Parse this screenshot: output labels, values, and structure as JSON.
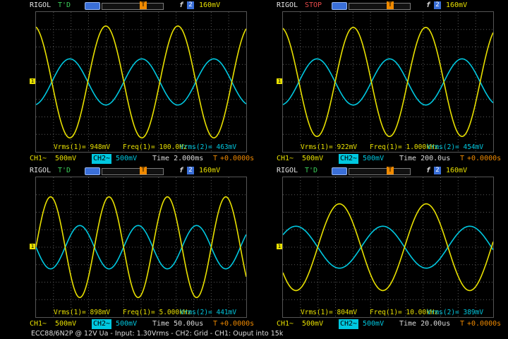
{
  "colors": {
    "ch1": "#e8e000",
    "ch2": "#00c8e0",
    "trigger": "#f08a00",
    "status_green": "#3cd05a"
  },
  "panels": [
    {
      "brand": "RIGOL",
      "status": "T'D",
      "trig_level": "160mV",
      "vrms1": "Vrms(1)= 948mV",
      "freq1": "Freq(1)= 100.0Hz",
      "vrms2": "Vrms(2)= 463mV",
      "ch1_label": "CH1~",
      "ch1_volt": "500mV",
      "ch2_label": "CH2~",
      "ch2_volt": "500mV",
      "time": "Time 2.000ms",
      "trig_pos": "+0.0000s",
      "cycles": 2.92,
      "phase": 0.78,
      "a1": 0.8,
      "a2": 0.33
    },
    {
      "brand": "RIGOL",
      "status": "STOP",
      "trig_level": "160mV",
      "vrms1": "Vrms(1)= 922mV",
      "freq1": "Freq(1)= 1.000kHz",
      "vrms2": "Vrms(2)= 454mV",
      "ch1_label": "CH1~",
      "ch1_volt": "500mV",
      "ch2_label": "CH2~",
      "ch2_volt": "500mV",
      "time": "Time 200.0us",
      "trig_pos": "+0.0000s",
      "cycles": 2.9,
      "phase": 0.78,
      "a1": 0.78,
      "a2": 0.33
    },
    {
      "brand": "RIGOL",
      "status": "T'D",
      "trig_level": "160mV",
      "vrms1": "Vrms(1)= 898mV",
      "freq1": "Freq(1)= 5.000kHz",
      "vrms2": "Vrms(2)= 441mV",
      "ch1_label": "CH1~",
      "ch1_volt": "500mV",
      "ch2_label": "CH2~",
      "ch2_volt": "500mV",
      "time": "Time 50.00us",
      "trig_pos": "+0.0000s",
      "cycles": 3.6,
      "phase": 0.5,
      "a1": 0.72,
      "a2": 0.31
    },
    {
      "brand": "RIGOL",
      "status": "T'D",
      "trig_level": "160mV",
      "vrms1": "Vrms(1)= 804mV",
      "freq1": "Freq(1)= 10.00kHz",
      "vrms2": "Vrms(2)= 389mV",
      "ch1_label": "CH1~",
      "ch1_volt": "500mV",
      "ch2_label": "CH2~",
      "ch2_volt": "500mV",
      "time": "Time 20.00us",
      "trig_pos": "+0.0000s",
      "cycles": 2.42,
      "phase": 0.1,
      "a1": 0.62,
      "a2": 0.3
    }
  ],
  "caption": "ECC88/6N2P @ 12V Ua - Input: 1.30Vrms - CH2: Grid - CH1: Ouput into 15k"
}
